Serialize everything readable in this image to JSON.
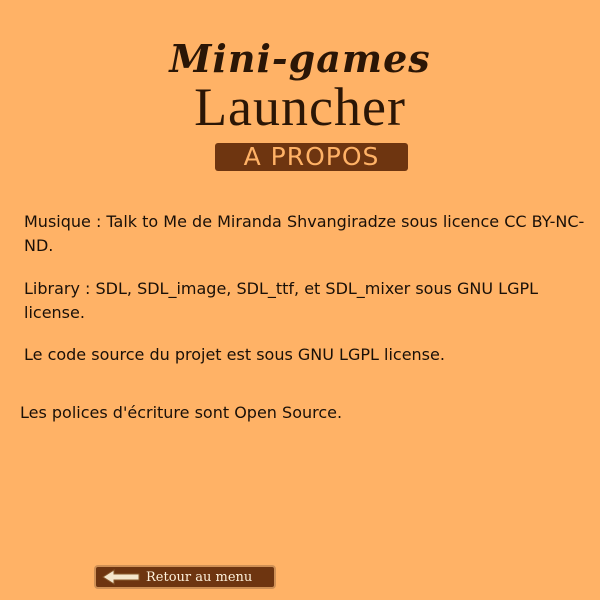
{
  "header": {
    "title_top": "Mini-games",
    "title_main": "Launcher",
    "section": "A PROPOS"
  },
  "content": {
    "music": "Musique : Talk to Me de Miranda Shvangiradze sous licence CC BY-NC-ND.",
    "library": "Library : SDL, SDL_image, SDL_ttf, et SDL_mixer sous GNU LGPL license.",
    "source": "Le code source du projet est sous GNU LGPL license.",
    "fonts": "Les polices d'écriture sont Open Source."
  },
  "footer": {
    "back_label": "Retour au menu",
    "back_icon": "left-arrow-icon"
  },
  "colors": {
    "background": "#FFB266",
    "banner": "#6e3510",
    "text": "#1a1008"
  }
}
